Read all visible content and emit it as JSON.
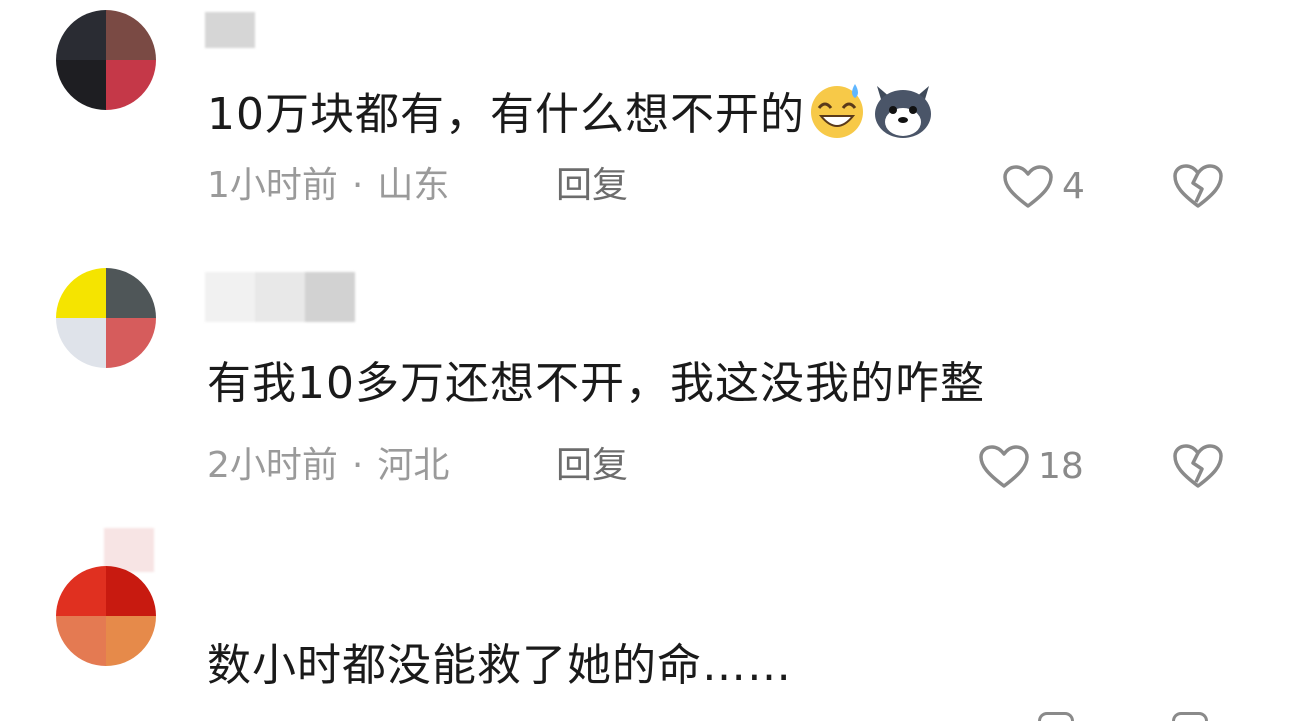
{
  "comments": [
    {
      "text": "10万块都有，有什么想不开的",
      "time": "1小时前",
      "location": "山东",
      "separator": "·",
      "reply_label": "回复",
      "likes": "4",
      "emojis": [
        "sweat-smile-emoji",
        "husky-dog-emoji"
      ]
    },
    {
      "text": "有我10多万还想不开，我这没我的咋整",
      "time": "2小时前",
      "location": "河北",
      "separator": "·",
      "reply_label": "回复",
      "likes": "18"
    },
    {
      "text": "数小时都没能救了她的命……"
    }
  ],
  "colors": {
    "text": "#1a1a1a",
    "meta": "#9a9a9a",
    "icon": "#8a8a8a"
  },
  "icons": {
    "like": "heart-outline-icon",
    "dislike": "broken-heart-icon"
  }
}
